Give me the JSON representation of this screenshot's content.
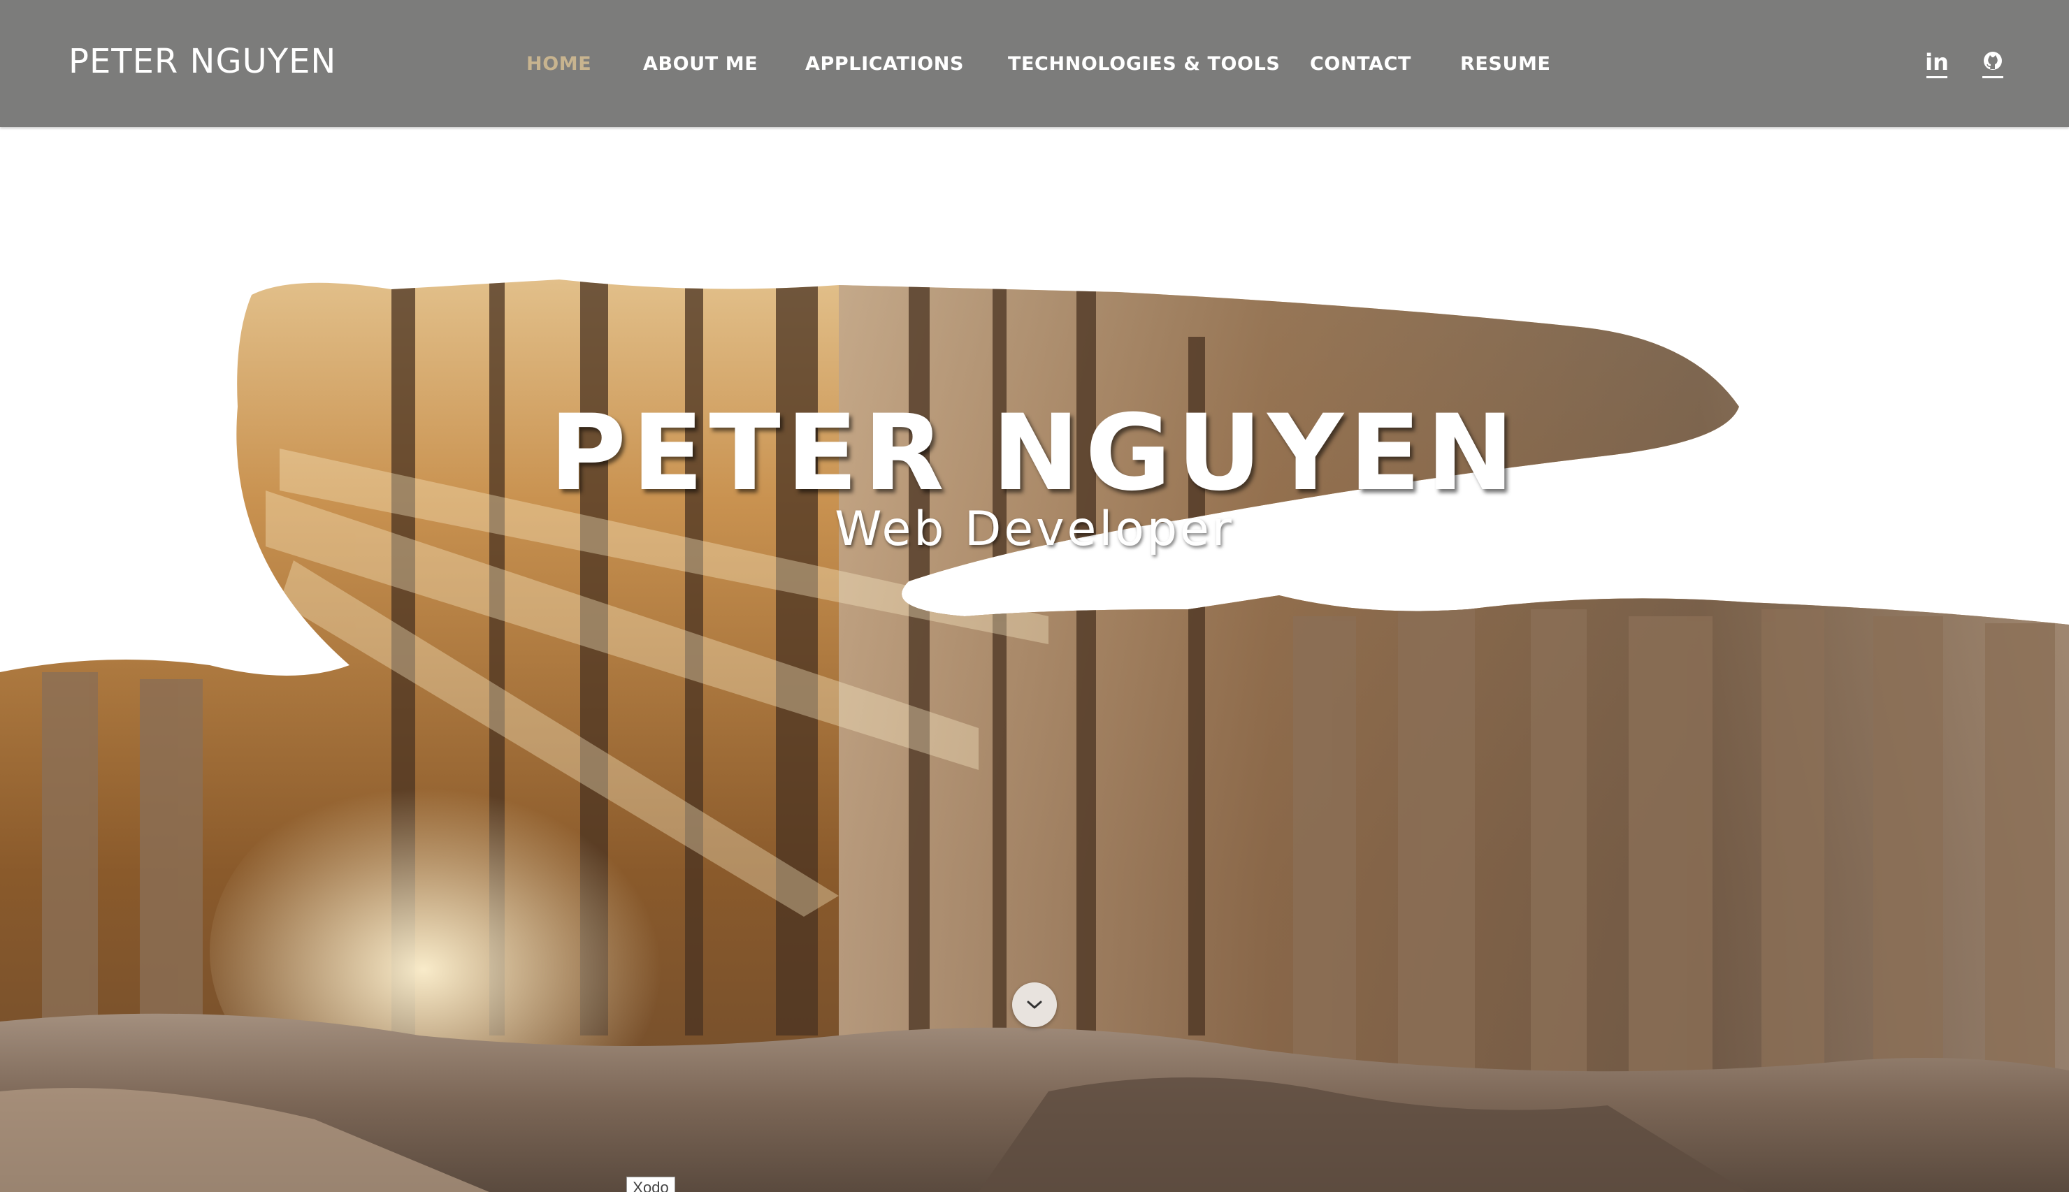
{
  "header": {
    "brand": "PETER NGUYEN",
    "nav": [
      {
        "label": "HOME",
        "active": true
      },
      {
        "label": "ABOUT ME",
        "active": false
      },
      {
        "label": "APPLICATIONS",
        "active": false
      },
      {
        "label": "TECHNOLOGIES & TOOLS",
        "active": false
      },
      {
        "label": "CONTACT",
        "active": false
      },
      {
        "label": "RESUME",
        "active": false
      }
    ],
    "social": [
      {
        "icon": "linkedin-icon",
        "glyph": "in"
      },
      {
        "icon": "github-icon"
      }
    ],
    "colors": {
      "bar": "#7c7c7b",
      "text": "#ffffff",
      "active": "#c8b48f"
    }
  },
  "hero": {
    "title": "PETER NGUYEN",
    "subtitle": "Web Developer",
    "scroll_icon": "chevron-down-icon",
    "tag": "Xodo"
  }
}
